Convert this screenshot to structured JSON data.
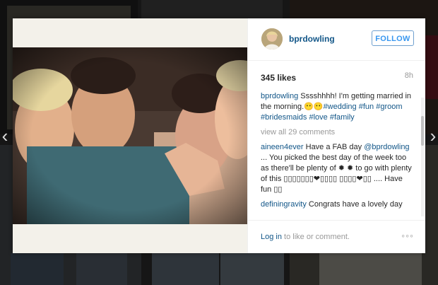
{
  "post": {
    "username": "bprdowling",
    "follow_label": "FOLLOW",
    "likes": "345 likes",
    "time": "8h",
    "caption": {
      "user": "bprdowling",
      "text": "Sssshhhh! I'm getting married in the morning.",
      "emoji": "😶😶",
      "tags": [
        "#wedding",
        "#fun",
        "#groom",
        "#bridesmaids",
        "#love",
        "#family"
      ]
    },
    "view_all": "view all 29 comments",
    "comments": [
      {
        "user": "aineen4ever",
        "text_a": "Have a FAB day",
        "mention": "@bprdowling",
        "text_b": "... You picked the best day of the week too as there'll be plenty of ✹ ✹ to go with plenty of this ▯▯▯▯▯▯▯❤▯▯▯▯ ▯▯▯▯❤▯▯ .... Have fun ▯▯"
      },
      {
        "user": "definingravity",
        "text": "Congrats have a lovely day"
      }
    ],
    "login_link": "Log in",
    "login_rest": " to like or comment.",
    "more_icon": "◦◦◦"
  },
  "nav": {
    "prev": "‹",
    "next": "›"
  },
  "icons": [
    "chevron-left-icon",
    "chevron-right-icon",
    "more-options-icon"
  ]
}
